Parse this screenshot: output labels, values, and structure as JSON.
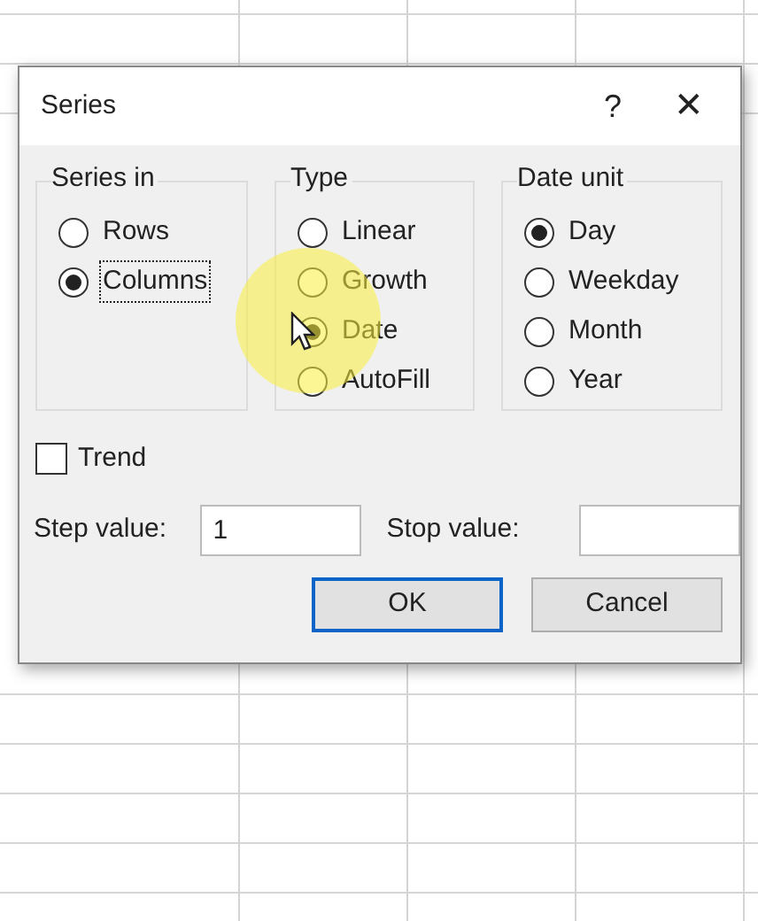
{
  "window": {
    "title": "Series",
    "help": "?",
    "close": "✕"
  },
  "groups": [
    {
      "title": "Series in",
      "options": [
        {
          "label": "Rows",
          "selected": false,
          "focused": false
        },
        {
          "label": "Columns",
          "selected": true,
          "focused": true
        }
      ]
    },
    {
      "title": "Type",
      "options": [
        {
          "label": "Linear",
          "selected": false,
          "focused": false
        },
        {
          "label": "Growth",
          "selected": false,
          "focused": false
        },
        {
          "label": "Date",
          "selected": true,
          "focused": false
        },
        {
          "label": "AutoFill",
          "selected": false,
          "focused": false
        }
      ]
    },
    {
      "title": "Date unit",
      "options": [
        {
          "label": "Day",
          "selected": true,
          "focused": false
        },
        {
          "label": "Weekday",
          "selected": false,
          "focused": false
        },
        {
          "label": "Month",
          "selected": false,
          "focused": false
        },
        {
          "label": "Year",
          "selected": false,
          "focused": false
        }
      ]
    }
  ],
  "trend": {
    "label": "Trend",
    "checked": false
  },
  "step": {
    "label": "Step value:",
    "value": "1"
  },
  "stop": {
    "label": "Stop value:"
  },
  "buttons": [
    {
      "label": "OK",
      "default": true
    },
    {
      "label": "Cancel",
      "default": false
    }
  ]
}
